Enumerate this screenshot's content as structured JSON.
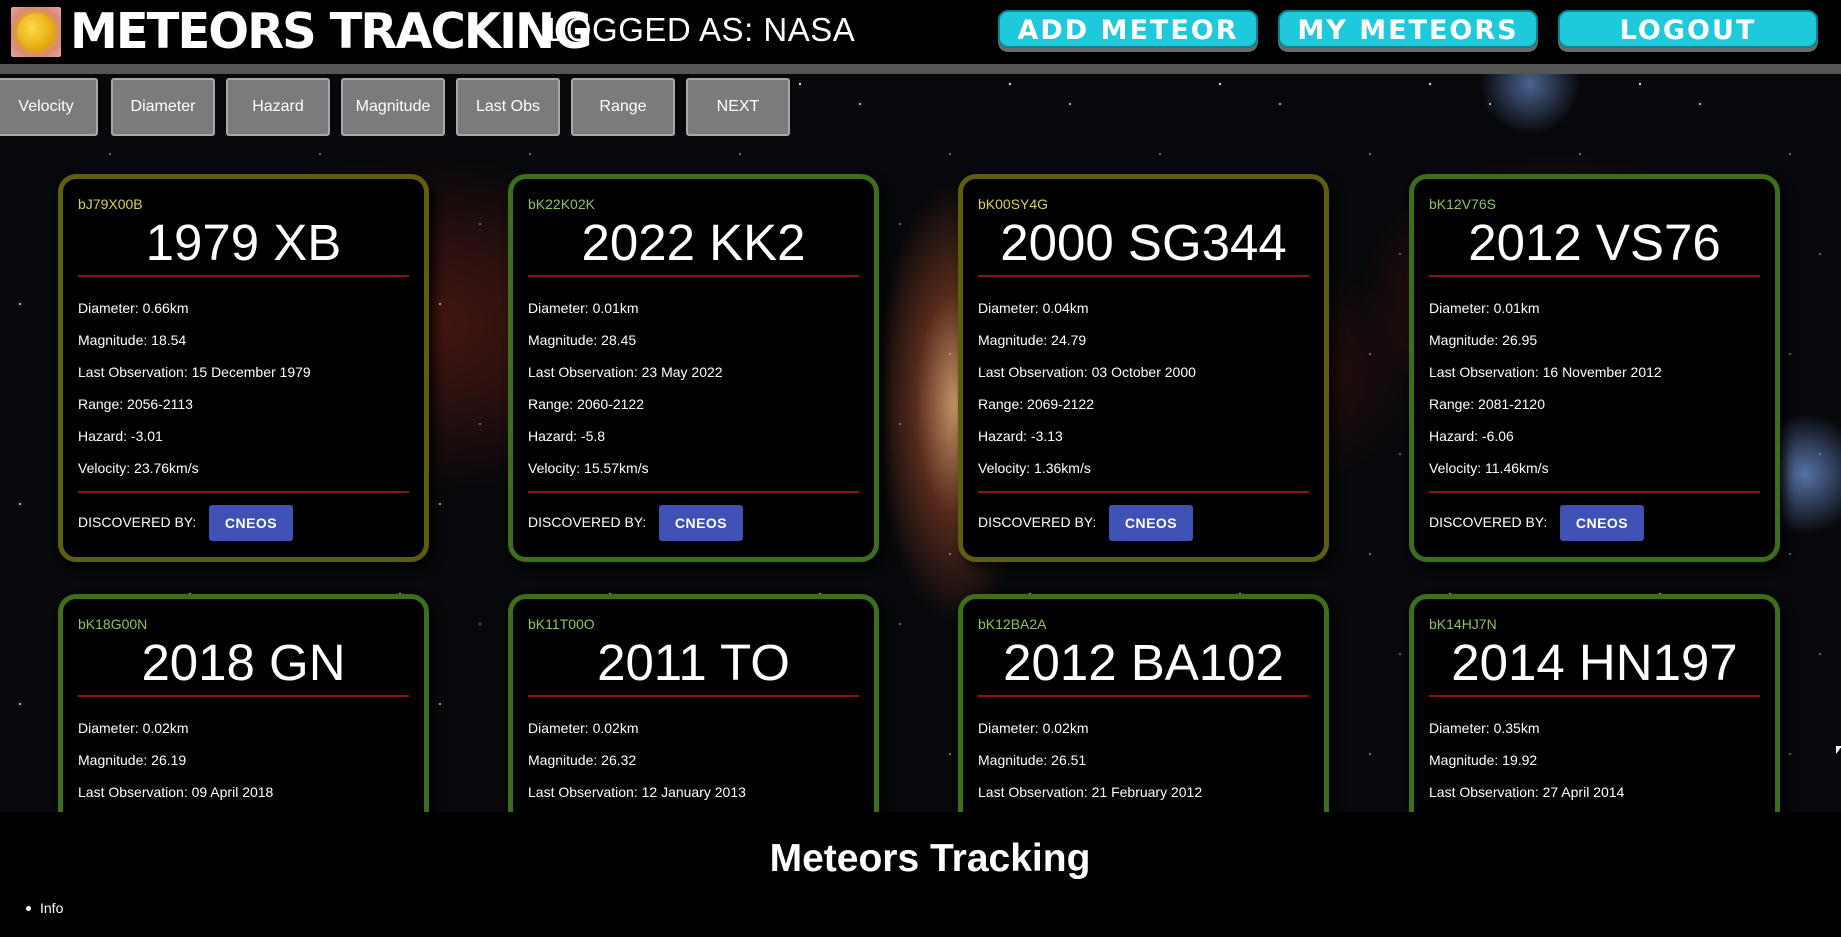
{
  "header": {
    "brand": "METEORS TRACKING",
    "logged_as": "LOGGED AS: NASA",
    "add_meteor": "ADD METEOR",
    "my_meteors": "MY METEORS",
    "logout": "LOGOUT"
  },
  "filters": [
    "Velocity",
    "Diameter",
    "Hazard",
    "Magnitude",
    "Last Obs",
    "Range",
    "NEXT"
  ],
  "cards": [
    {
      "id": "bJ79X00B",
      "name": "1979 XB",
      "diameter": "Diameter: 0.66km",
      "magnitude": "Magnitude: 18.54",
      "last_obs": "Last Observation: 15 December 1979",
      "range": "Range: 2056-2113",
      "hazard": "Hazard: -3.01",
      "velocity": "Velocity: 23.76km/s",
      "discovered_label": "DISCOVERED BY:",
      "discovered_by": "CNEOS",
      "border": "#5f5d10"
    },
    {
      "id": "bK22K02K",
      "name": "2022 KK2",
      "diameter": "Diameter: 0.01km",
      "magnitude": "Magnitude: 28.45",
      "last_obs": "Last Observation: 23 May 2022",
      "range": "Range: 2060-2122",
      "hazard": "Hazard: -5.8",
      "velocity": "Velocity: 15.57km/s",
      "discovered_label": "DISCOVERED BY:",
      "discovered_by": "CNEOS",
      "border": "#3e6e1b"
    },
    {
      "id": "bK00SY4G",
      "name": "2000 SG344",
      "diameter": "Diameter: 0.04km",
      "magnitude": "Magnitude: 24.79",
      "last_obs": "Last Observation: 03 October 2000",
      "range": "Range: 2069-2122",
      "hazard": "Hazard: -3.13",
      "velocity": "Velocity: 1.36km/s",
      "discovered_label": "DISCOVERED BY:",
      "discovered_by": "CNEOS",
      "border": "#5f5d10"
    },
    {
      "id": "bK12V76S",
      "name": "2012 VS76",
      "diameter": "Diameter: 0.01km",
      "magnitude": "Magnitude: 26.95",
      "last_obs": "Last Observation: 16 November 2012",
      "range": "Range: 2081-2120",
      "hazard": "Hazard: -6.06",
      "velocity": "Velocity: 11.46km/s",
      "discovered_label": "DISCOVERED BY:",
      "discovered_by": "CNEOS",
      "border": "#3e6e1b"
    },
    {
      "id": "bK18G00N",
      "name": "2018 GN",
      "diameter": "Diameter: 0.02km",
      "magnitude": "Magnitude: 26.19",
      "last_obs": "Last Observation: 09 April 2018",
      "border": "#3e6e1b"
    },
    {
      "id": "bK11T00O",
      "name": "2011 TO",
      "diameter": "Diameter: 0.02km",
      "magnitude": "Magnitude: 26.32",
      "last_obs": "Last Observation: 12 January 2013",
      "border": "#3e6e1b"
    },
    {
      "id": "bK12BA2A",
      "name": "2012 BA102",
      "diameter": "Diameter: 0.02km",
      "magnitude": "Magnitude: 26.51",
      "last_obs": "Last Observation: 21 February 2012",
      "border": "#3e6e1b"
    },
    {
      "id": "bK14HJ7N",
      "name": "2014 HN197",
      "diameter": "Diameter: 0.35km",
      "magnitude": "Magnitude: 19.92",
      "last_obs": "Last Observation: 27 April 2014",
      "border": "#3e6e1b"
    }
  ],
  "footer": {
    "title": "Meteors Tracking",
    "links": [
      "Info"
    ]
  },
  "colors": {
    "header_button": "#1fc9dc",
    "cneos_button": "#3f51b5",
    "card_rule": "#8a1414",
    "id_green": "#8fc35c",
    "id_yellow": "#d9d24a"
  }
}
